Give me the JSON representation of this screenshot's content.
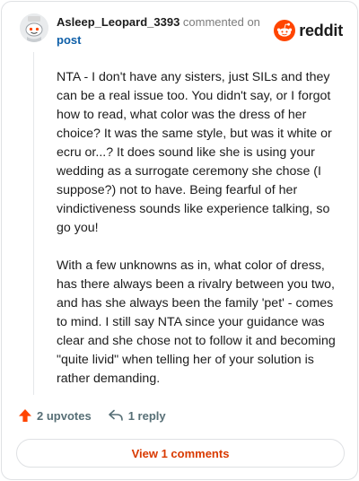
{
  "comment": {
    "username": "Asleep_Leopard_3393",
    "action_text": "commented on",
    "post_link": "post",
    "paragraphs": [
      "NTA - I don't have any sisters, just SILs and they can be a real issue too. You didn't say, or I forgot how to read, what color was the dress of her choice? It was the same style, but was it white or ecru or...? It does sound like she is using your wedding as a surrogate ceremony she chose (I suppose?) not to have. Being fearful of her vindictiveness sounds like experience talking, so go you!",
      "With a few unknowns as in, what color of dress, has there always been a rivalry between you two, and has she always been the family 'pet' - comes to mind. I still say NTA since your guidance was clear and she chose not to follow it and becoming \"quite livid\" when telling her of your solution is rather demanding."
    ]
  },
  "brand": {
    "wordmark": "reddit",
    "icon": "reddit-logo-icon",
    "color": "#ff4500"
  },
  "actions": {
    "upvotes": "2 upvotes",
    "reply": "1 reply",
    "upvote_icon": "upvote-arrow-icon",
    "reply_icon": "reply-arrow-icon"
  },
  "footer": {
    "view_comments": "View 1 comments"
  },
  "colors": {
    "accent": "#ff4500",
    "link": "#0e5fa8",
    "button_text": "#d93a00",
    "muted": "#576f76"
  }
}
